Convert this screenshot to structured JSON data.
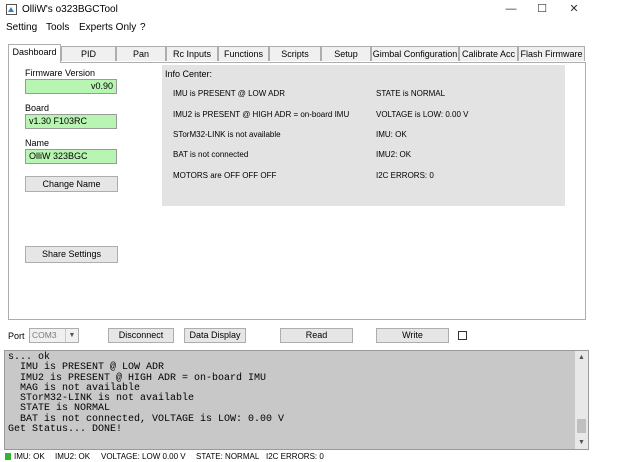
{
  "window": {
    "title": "OlliW's o323BGCTool",
    "minimize": "—",
    "maximize": "☐",
    "close": "✕"
  },
  "menu": [
    "Setting",
    "Tools",
    "Experts Only",
    "?"
  ],
  "tabs": [
    {
      "label": "Dashboard",
      "active": true
    },
    {
      "label": "PID"
    },
    {
      "label": "Pan"
    },
    {
      "label": "Rc Inputs"
    },
    {
      "label": "Functions"
    },
    {
      "label": "Scripts"
    },
    {
      "label": "Setup"
    },
    {
      "label": "Gimbal Configuration"
    },
    {
      "label": "Calibrate Acc"
    },
    {
      "label": "Flash Firmware"
    }
  ],
  "dashboard": {
    "firmware_label": "Firmware Version",
    "firmware_value": "v0.90",
    "board_label": "Board",
    "board_value": "v1.30 F103RC",
    "name_label": "Name",
    "name_value": "OlliW 323BGC",
    "change_name_button": "Change Name",
    "share_settings_button": "Share Settings"
  },
  "info_center": {
    "title": "Info Center:",
    "left": [
      "IMU is PRESENT @ LOW ADR",
      "IMU2 is PRESENT @ HIGH ADR = on-board IMU",
      "STorM32-LINK is not available",
      "BAT is not connected",
      "MOTORS are OFF OFF OFF"
    ],
    "right": [
      "STATE is NORMAL",
      "VOLTAGE is LOW: 0.00 V",
      "IMU: OK",
      "IMU2: OK",
      "I2C ERRORS: 0"
    ]
  },
  "controls": {
    "port_label": "Port",
    "port_value": "COM3",
    "connect_button": "Disconnect",
    "data_display_button": "Data Display",
    "read_button": "Read",
    "write_button": "Write",
    "checkbox_checked": false
  },
  "console": {
    "text": "s... ok\n  IMU is PRESENT @ LOW ADR\n  IMU2 is PRESENT @ HIGH ADR = on-board IMU\n  MAG is not available\n  STorM32-LINK is not available\n  STATE is NORMAL\n  BAT is not connected, VOLTAGE is LOW: 0.00 V\nGet Status... DONE!"
  },
  "status": {
    "led_color": "#2fb52f",
    "imu": "IMU: OK",
    "imu2": "IMU2: OK",
    "voltage": "VOLTAGE: LOW 0.00 V",
    "state": "STATE: NORMAL",
    "i2c": "I2C ERRORS: 0"
  },
  "colors": {
    "value_box": "#b8f5b2",
    "info_panel": "#e3e3e3",
    "console_bg": "#c8c8c8"
  }
}
